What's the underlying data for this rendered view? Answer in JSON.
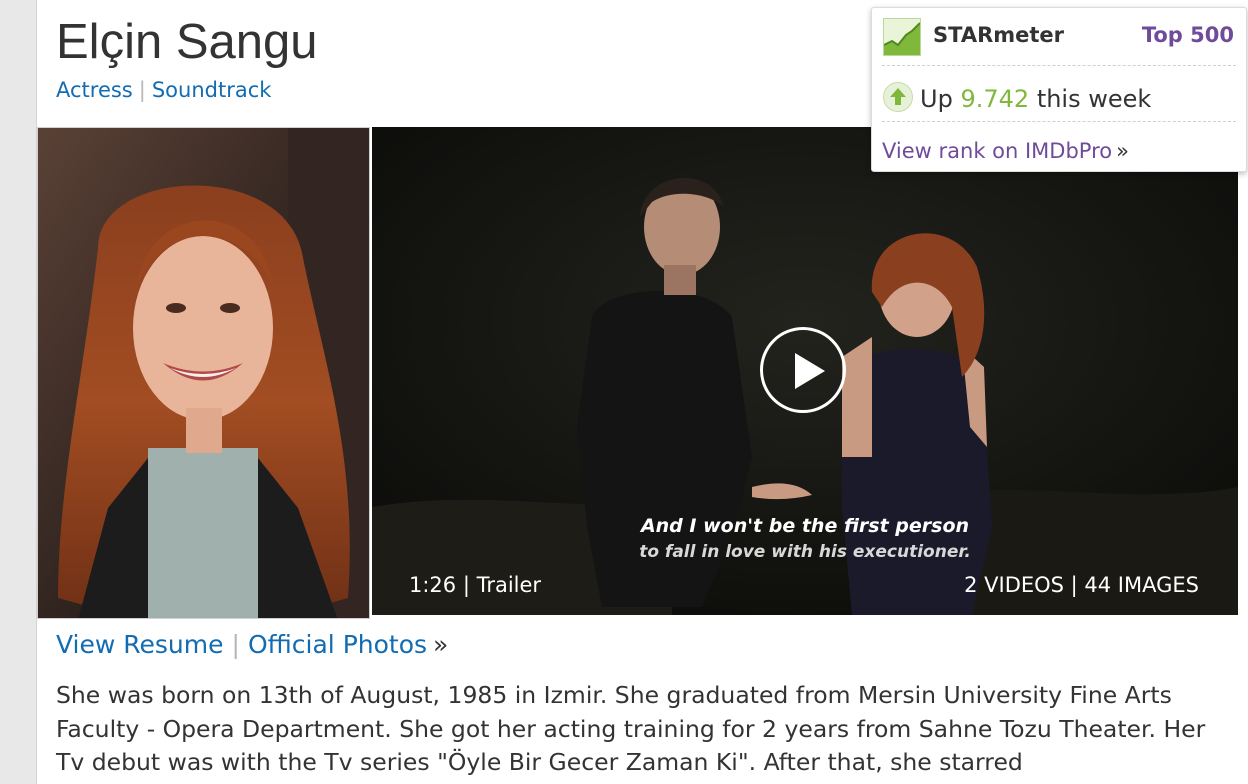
{
  "person": {
    "name": "Elçin Sangu",
    "roles": [
      "Actress",
      "Soundtrack"
    ]
  },
  "video": {
    "subtitle_line1": "And I won't be the first person",
    "subtitle_line2": "to fall in love with his executioner.",
    "duration_label": "1:26 | Trailer",
    "media_counts": "2 VIDEOS | 44 IMAGES"
  },
  "links": {
    "view_resume": "View Resume",
    "official_photos": "Official Photos",
    "raquo": "»"
  },
  "bio": {
    "text": "She was born on 13th of August, 1985 in Izmir. She graduated from Mersin University Fine Arts Faculty - Opera Department. She got her acting training for 2 years from Sahne Tozu Theater. Her Tv debut was with the Tv series \"Öyle Bir Gecer Zaman Ki\". After that, she starred"
  },
  "starmeter": {
    "title": "STARmeter",
    "rank": "Top 500",
    "change_prefix": "Up",
    "change_value": "9.742",
    "change_suffix": "this week",
    "link": "View rank on IMDbPro",
    "raquo": "»"
  },
  "colors": {
    "link_blue": "#136cb2",
    "imdbpro_purple": "#6f4b9a",
    "up_green": "#7fb83b"
  }
}
